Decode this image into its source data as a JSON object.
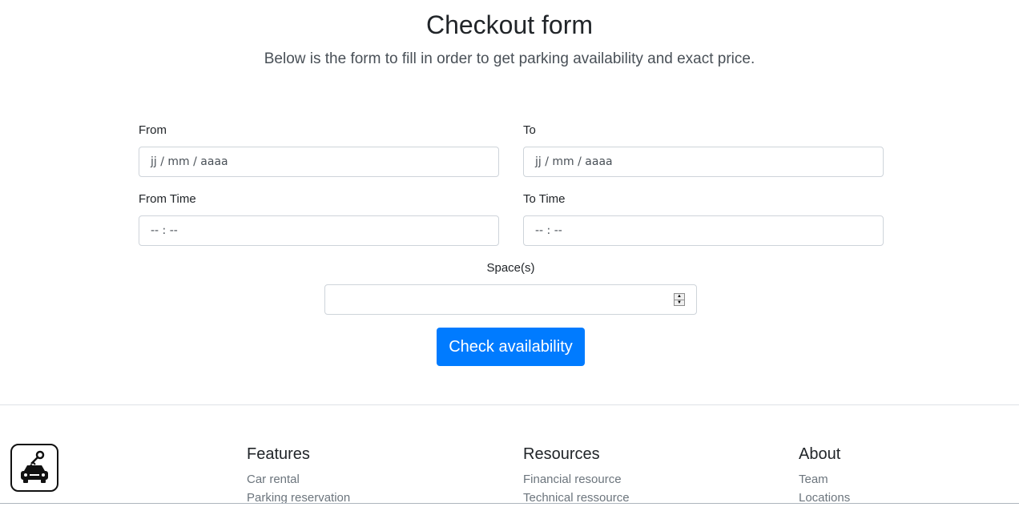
{
  "header": {
    "title": "Checkout form",
    "lead": "Below is the form to fill in order to get parking availability and exact price."
  },
  "form": {
    "from": {
      "label": "From",
      "placeholder": "jj / mm / aaaa"
    },
    "to": {
      "label": "To",
      "placeholder": "jj / mm / aaaa"
    },
    "from_time": {
      "label": "From Time",
      "placeholder": "-- : --"
    },
    "to_time": {
      "label": "To Time",
      "placeholder": "-- : --"
    },
    "spaces": {
      "label": "Space(s)",
      "value": ""
    },
    "submit_label": "Check availability"
  },
  "footer": {
    "logo_icon": "car-key-icon",
    "columns": [
      {
        "heading": "Features",
        "links": [
          "Car rental",
          "Parking reservation"
        ]
      },
      {
        "heading": "Resources",
        "links": [
          "Financial resource",
          "Technical ressource"
        ]
      },
      {
        "heading": "About",
        "links": [
          "Team",
          "Locations"
        ]
      }
    ]
  },
  "colors": {
    "primary": "#007bff",
    "text": "#212529",
    "muted": "#6c757d",
    "border": "#ced4da"
  }
}
